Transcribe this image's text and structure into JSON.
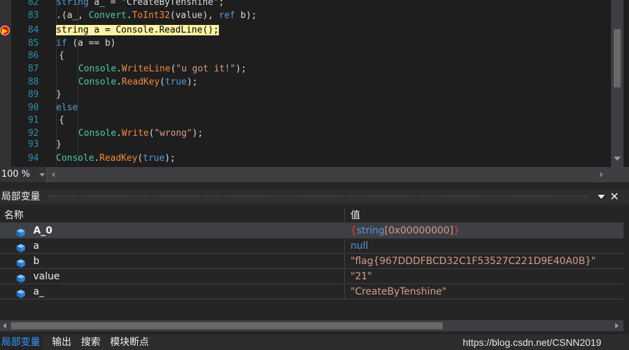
{
  "editor": {
    "lines": [
      {
        "num": "82",
        "parts": [
          {
            "t": "string",
            "c": "kw"
          },
          {
            "t": " a_ = \"CreateByTenshine\";",
            "c": "str-ish"
          }
        ]
      },
      {
        "num": "83",
        "parts": [
          {
            "t": ".(a_, ",
            "c": ""
          },
          {
            "t": "Convert",
            "c": "cls"
          },
          {
            "t": ".",
            "c": ""
          },
          {
            "t": "ToInt32",
            "c": "orange"
          },
          {
            "t": "(value), ",
            "c": ""
          },
          {
            "t": "ref",
            "c": "kw"
          },
          {
            "t": " b);",
            "c": ""
          }
        ]
      },
      {
        "num": "84",
        "parts": [
          {
            "t": "string a = Console.ReadLine();",
            "c": "hl"
          }
        ]
      },
      {
        "num": "85",
        "parts": [
          {
            "t": "if",
            "c": "kw"
          },
          {
            "t": " (a == b)",
            "c": ""
          }
        ]
      },
      {
        "num": "86",
        "parts": [
          {
            "t": "{",
            "c": ""
          }
        ]
      },
      {
        "num": "87",
        "parts": [
          {
            "t": "Console",
            "c": "cls"
          },
          {
            "t": ".",
            "c": ""
          },
          {
            "t": "WriteLine",
            "c": "orange"
          },
          {
            "t": "(",
            "c": ""
          },
          {
            "t": "\"u got it!\"",
            "c": "str"
          },
          {
            "t": ");",
            "c": ""
          }
        ]
      },
      {
        "num": "88",
        "parts": [
          {
            "t": "Console",
            "c": "cls"
          },
          {
            "t": ".",
            "c": ""
          },
          {
            "t": "ReadKey",
            "c": "orange"
          },
          {
            "t": "(",
            "c": ""
          },
          {
            "t": "true",
            "c": "kw"
          },
          {
            "t": ");",
            "c": ""
          }
        ]
      },
      {
        "num": "89",
        "parts": [
          {
            "t": "}",
            "c": ""
          }
        ]
      },
      {
        "num": "90",
        "parts": [
          {
            "t": "else",
            "c": "kw"
          }
        ]
      },
      {
        "num": "91",
        "parts": [
          {
            "t": "{",
            "c": ""
          }
        ]
      },
      {
        "num": "92",
        "parts": [
          {
            "t": "Console",
            "c": "cls"
          },
          {
            "t": ".",
            "c": ""
          },
          {
            "t": "Write",
            "c": "orange"
          },
          {
            "t": "(",
            "c": ""
          },
          {
            "t": "\"wrong\"",
            "c": "str"
          },
          {
            "t": ");",
            "c": ""
          }
        ]
      },
      {
        "num": "93",
        "parts": [
          {
            "t": "}",
            "c": ""
          }
        ]
      },
      {
        "num": "94",
        "parts": [
          {
            "t": "Console",
            "c": "cls"
          },
          {
            "t": ".",
            "c": ""
          },
          {
            "t": "ReadKey",
            "c": "orange"
          },
          {
            "t": "(",
            "c": ""
          },
          {
            "t": "true",
            "c": "kw"
          },
          {
            "t": ");",
            "c": ""
          }
        ]
      }
    ],
    "zoom": "100 %"
  },
  "locals": {
    "title": "局部变量",
    "col_name": "名称",
    "col_value": "值",
    "rows": [
      {
        "name": "A_0",
        "bold": true,
        "value_parts": [
          {
            "t": "{",
            "c": "v-red"
          },
          {
            "t": "string",
            "c": "v-kw"
          },
          {
            "t": "[0x00000000]",
            "c": "v-str"
          },
          {
            "t": "}",
            "c": "v-red"
          }
        ]
      },
      {
        "name": "a",
        "bold": false,
        "value_parts": [
          {
            "t": "null",
            "c": "v-kw"
          }
        ]
      },
      {
        "name": "b",
        "bold": false,
        "value_parts": [
          {
            "t": "\"flag{967DDDFBCD32C1F53527C221D9E40A0B}\"",
            "c": "v-str"
          }
        ]
      },
      {
        "name": "value",
        "bold": false,
        "value_parts": [
          {
            "t": "\"21\"",
            "c": "v-str"
          }
        ]
      },
      {
        "name": "a_",
        "bold": false,
        "value_parts": [
          {
            "t": "\"CreateByTenshine\"",
            "c": "v-str"
          }
        ]
      }
    ]
  },
  "tabs": [
    {
      "label": "局部变量",
      "active": true
    },
    {
      "label": "输出",
      "active": false
    },
    {
      "label": "搜索",
      "active": false
    },
    {
      "label": "模块断点",
      "active": false
    }
  ],
  "watermark": "https://blog.csdn.net/CSNN2019",
  "colors": {
    "keyword": "#569cd6",
    "type": "#4ec9b0",
    "string": "#d69d85",
    "method": "#f08b3a",
    "highlight": "#faf2a5",
    "active_tab": "#3399ff"
  }
}
